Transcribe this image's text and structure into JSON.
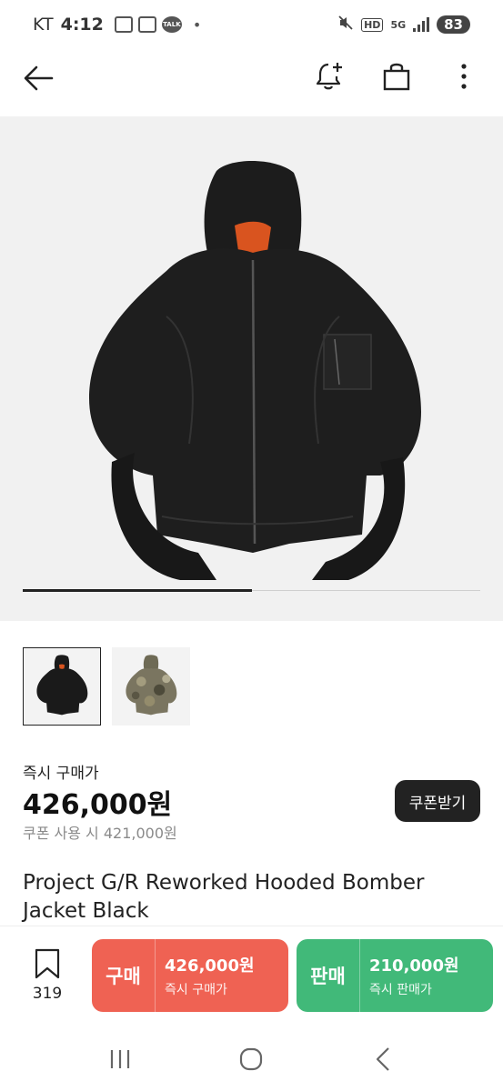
{
  "status_bar": {
    "carrier": "KT",
    "time": "4:12",
    "talk_label": "TALK",
    "dot": "•",
    "hd": "HD",
    "network": "5G",
    "battery": "83"
  },
  "icons": {
    "back": "back-arrow-icon",
    "bell": "bell-plus-icon",
    "bag": "shopping-bag-icon",
    "more": "more-vertical-icon",
    "bookmark": "bookmark-icon"
  },
  "gallery": {
    "image_alt": "black hooded bomber jacket",
    "progress": 0.5
  },
  "thumbnails": [
    {
      "name": "black",
      "color": "#1a1a1a"
    },
    {
      "name": "camo",
      "color": "#7a7560"
    }
  ],
  "price": {
    "label": "즉시 구매가",
    "value": "426,000원",
    "coupon_text": "쿠폰 사용 시 421,000원",
    "coupon_button": "쿠폰받기"
  },
  "product": {
    "title": "Project G/R Reworked Hooded Bomber Jacket Black"
  },
  "actions": {
    "wish_count": "319",
    "buy": {
      "kind": "구매",
      "price": "426,000원",
      "sub": "즉시 구매가",
      "color": "#ef6253"
    },
    "sell": {
      "kind": "판매",
      "price": "210,000원",
      "sub": "즉시 판매가",
      "color": "#41b979"
    }
  },
  "system_nav": {
    "recents": "recents-icon",
    "home": "home-icon",
    "back": "system-back-icon"
  }
}
